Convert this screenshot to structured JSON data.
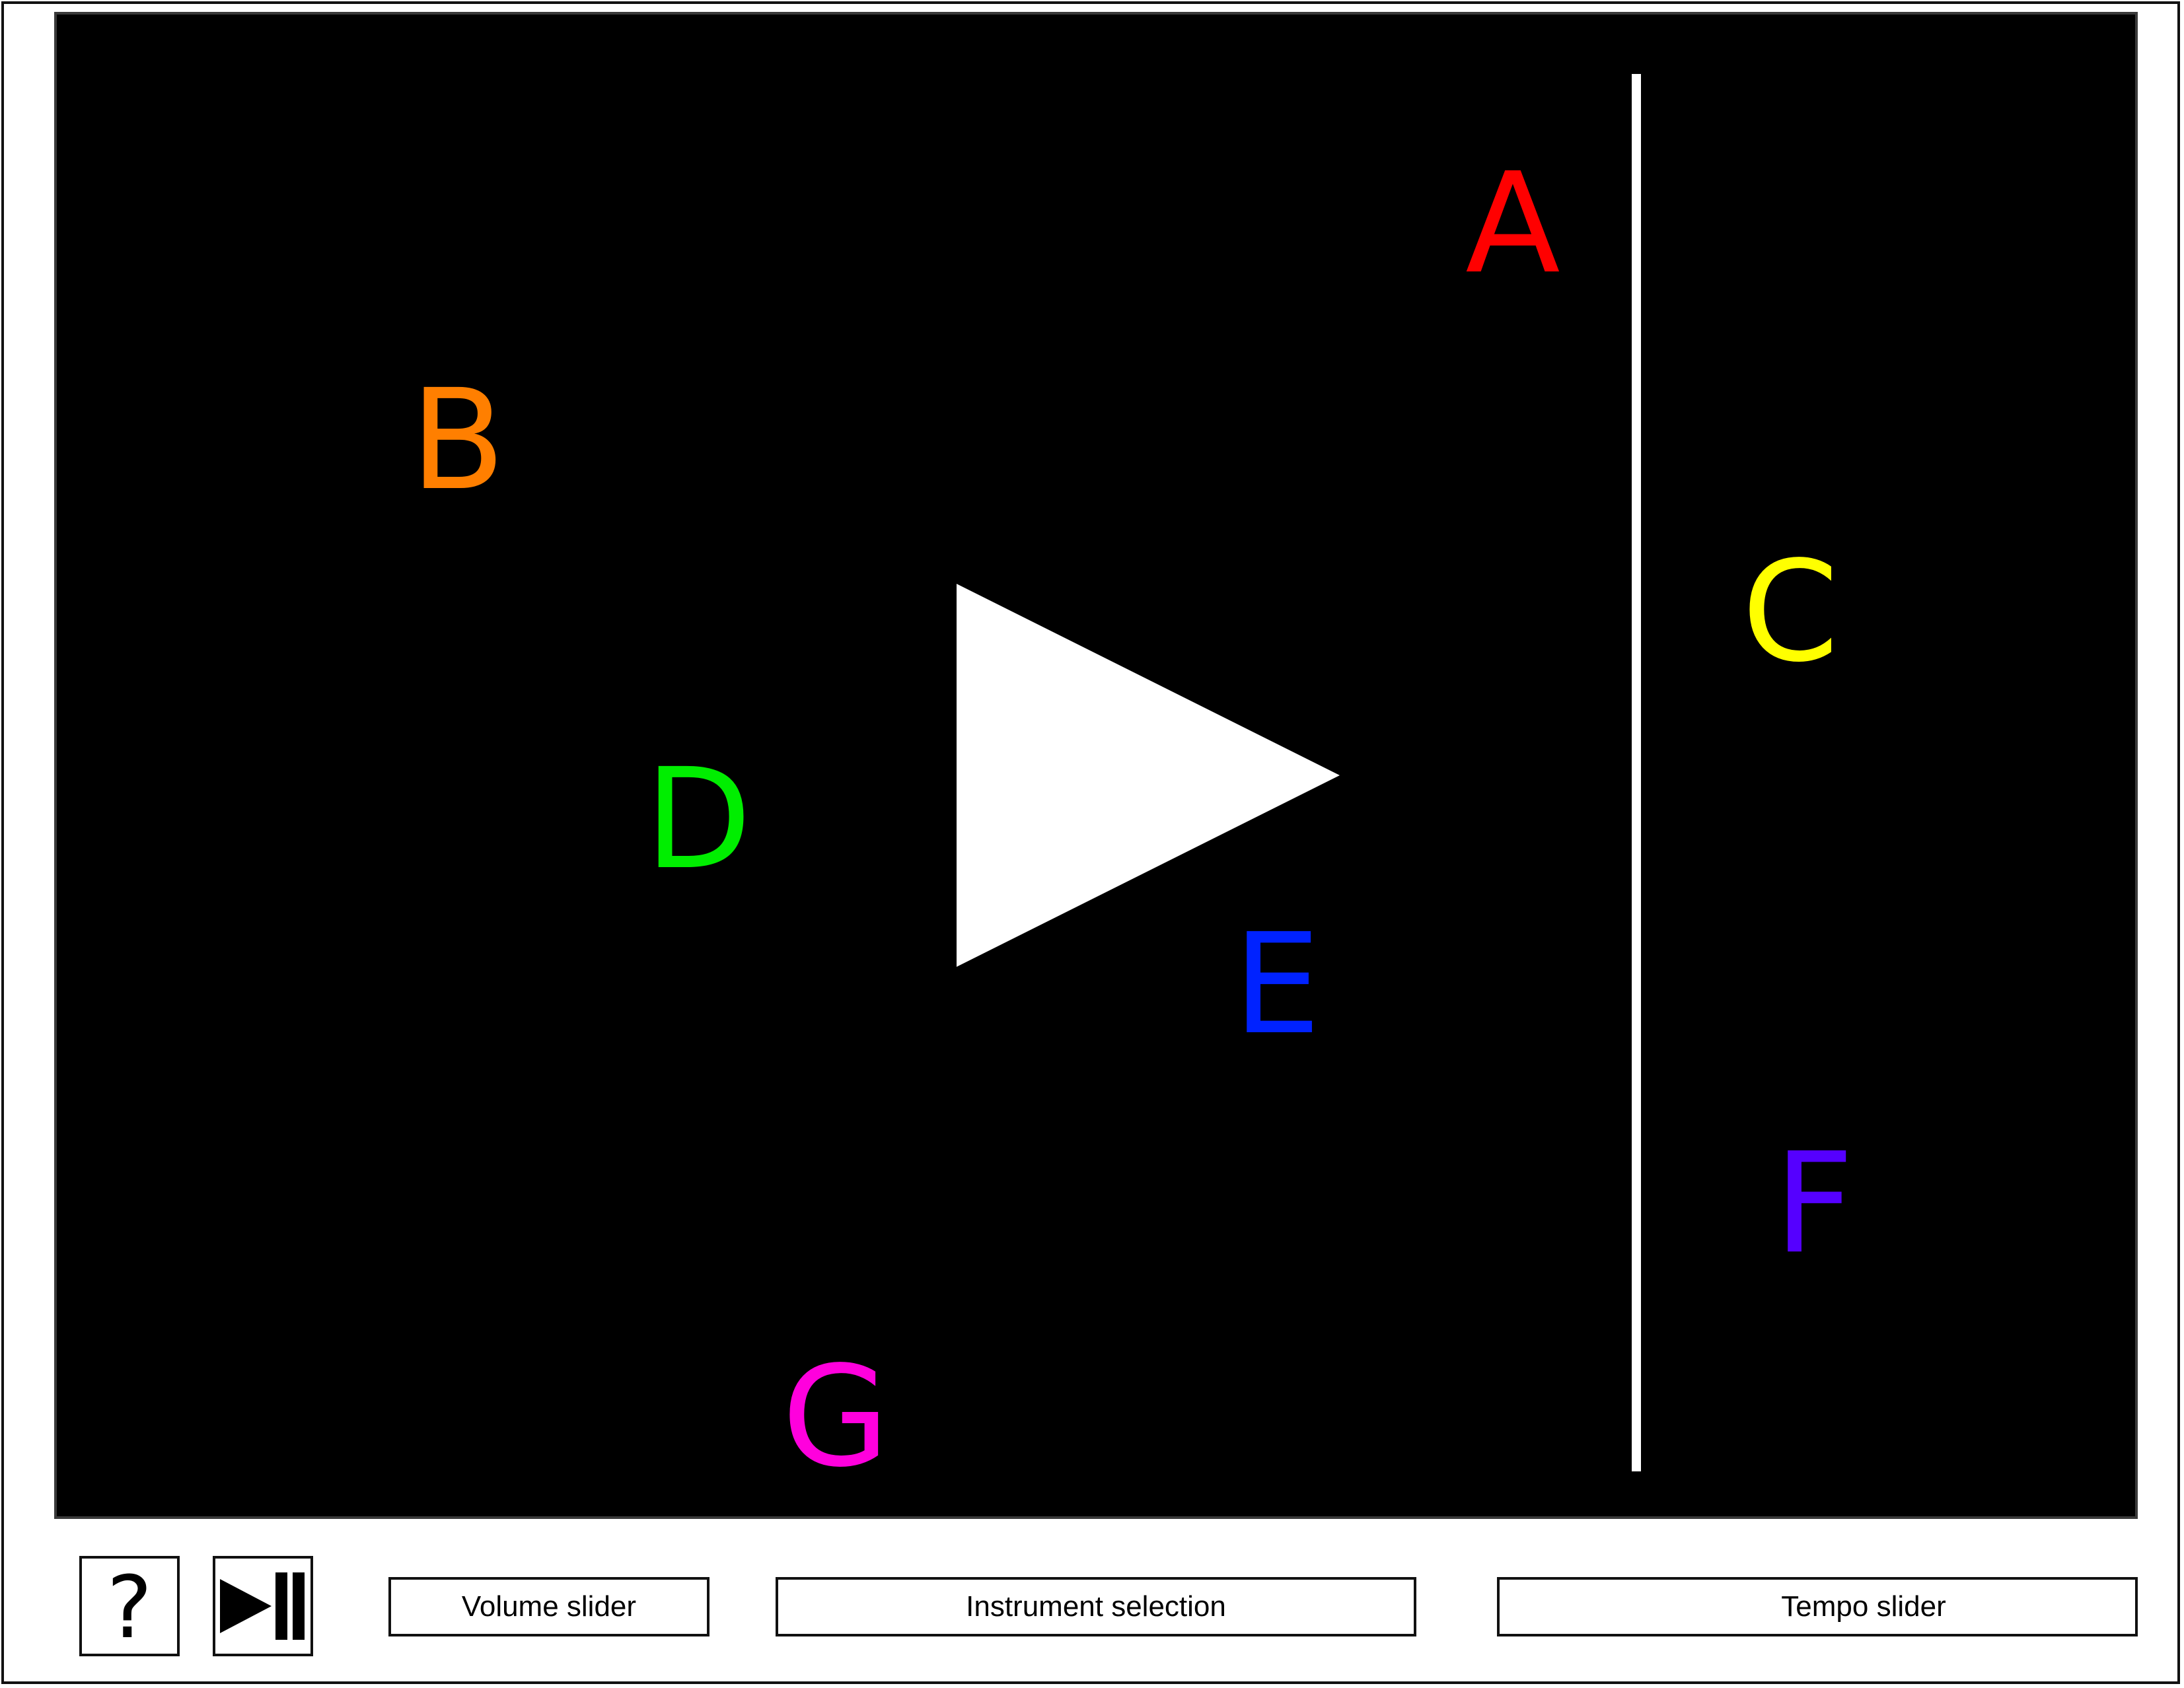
{
  "stage": {
    "notes": [
      {
        "label": "A",
        "color": "#ff0000"
      },
      {
        "label": "B",
        "color": "#ff7f00"
      },
      {
        "label": "C",
        "color": "#ffff00"
      },
      {
        "label": "D",
        "color": "#00ee00"
      },
      {
        "label": "E",
        "color": "#0022ff"
      },
      {
        "label": "F",
        "color": "#5500ff"
      },
      {
        "label": "G",
        "color": "#ff00dd"
      }
    ],
    "play_icon": "play-triangle-icon"
  },
  "toolbar": {
    "help_icon": "question-mark-icon",
    "help_label": "?",
    "playpause_icon": "play-pause-icon",
    "volume_label": "Volume slider",
    "instrument_label": "Instrument selection",
    "tempo_label": "Tempo slider"
  }
}
